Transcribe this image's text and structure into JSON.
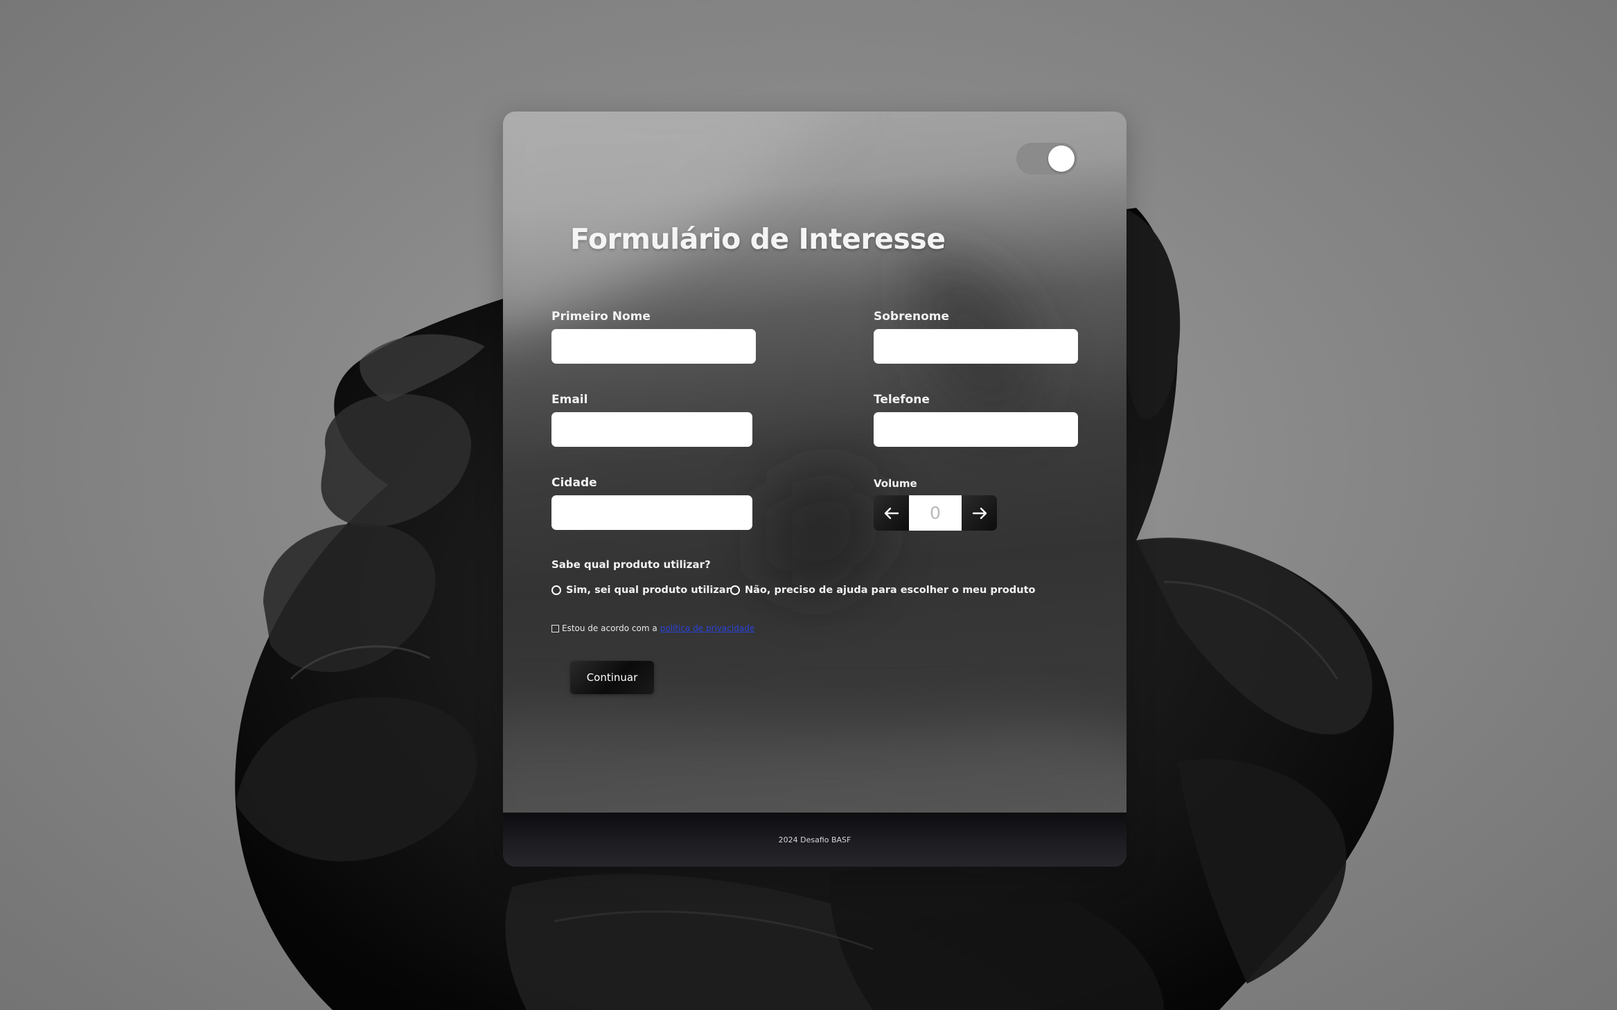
{
  "form": {
    "title": "Formulário de Interesse",
    "theme_toggle": {
      "state": "on"
    },
    "fields": {
      "first_name": {
        "label": "Primeiro Nome",
        "value": ""
      },
      "last_name": {
        "label": "Sobrenome",
        "value": ""
      },
      "email": {
        "label": "Email",
        "value": ""
      },
      "phone": {
        "label": "Telefone",
        "value": ""
      },
      "city": {
        "label": "Cidade",
        "value": ""
      }
    },
    "volume": {
      "label": "Volume",
      "value": "0",
      "decrement_icon": "arrow-left-icon",
      "increment_icon": "arrow-right-icon"
    },
    "product_question": {
      "label": "Sabe qual produto utilizar?",
      "options": [
        {
          "label": "Sim, sei qual produto utilizar",
          "selected": false
        },
        {
          "label": "Não, preciso de ajuda para escolher o meu produto",
          "selected": false
        }
      ]
    },
    "consent": {
      "text": "Estou de acordo com a",
      "link_text": "política de privacidade",
      "checked": false
    },
    "submit_label": "Continuar"
  },
  "footer": {
    "text": "2024 Desafio BASF"
  },
  "colors": {
    "card_top": "#a7a7a7",
    "card_mid": "#3c3c3c",
    "footer_bg": "#16161a",
    "button_bg": "#0b0b0b",
    "link": "#2a44d8",
    "input_bg": "#ffffff"
  }
}
